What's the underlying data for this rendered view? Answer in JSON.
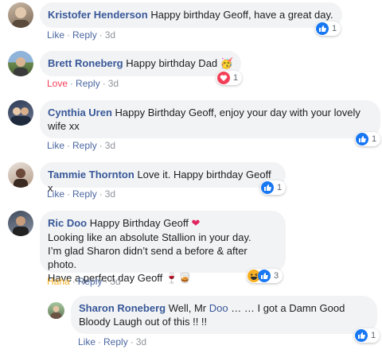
{
  "colors": {
    "link_blue": "#385898",
    "action_blue": "#4b67a1",
    "love_red": "#f33e58",
    "haha_orange": "#f7b125",
    "bubble_bg": "#f2f3f5"
  },
  "comments": [
    {
      "author": "Kristofer Henderson",
      "text": "Happy birthday Geoff, have a great day.",
      "action": "Like",
      "reply": "Reply",
      "time": "3d",
      "reaction_icon": "like-icon",
      "reaction_count": "1"
    },
    {
      "author": "Brett Roneberg",
      "text": "Happy birthday Dad",
      "emoji": "🥳",
      "action": "Love",
      "reply": "Reply",
      "time": "3d",
      "reaction_icon": "love-icon",
      "reaction_count": "1"
    },
    {
      "author": "Cynthia Uren",
      "text_line1": "Happy Birthday Geoff, enjoy your day with your lovely",
      "text_line2": "wife xx",
      "action": "Like",
      "reply": "Reply",
      "time": "3d",
      "reaction_icon": "like-icon",
      "reaction_count": "1"
    },
    {
      "author": "Tammie Thornton",
      "text": "Love it. Happy birthday Geoff x",
      "action": "Like",
      "reply": "Reply",
      "time": "3d",
      "reaction_icon": "like-icon",
      "reaction_count": "1"
    },
    {
      "author": "Ric Doo",
      "text_line1": "Happy Birthday Geoff",
      "heart": "❤",
      "text_line2": "Looking like an absolute Stallion in your day.",
      "text_line3": "I’m glad Sharon didn’t send a before & after photo.",
      "text_line4": "Have a perfect day Geoff",
      "drink_emojis": "🍷🥃",
      "action": "Haha",
      "reply": "Reply",
      "time": "3d",
      "reaction_icons": [
        "haha-icon",
        "like-icon"
      ],
      "reaction_count": "3"
    },
    {
      "author": "Sharon Roneberg",
      "text_line1": "Well, Mr",
      "mention": "Doo",
      "text_line1_rest": "… … I got a Damn Good",
      "text_line2": "Bloody Laugh out of this !! !!",
      "action": "Like",
      "reply": "Reply",
      "time": "3d",
      "reaction_icon": "like-icon",
      "reaction_count": "1"
    }
  ]
}
